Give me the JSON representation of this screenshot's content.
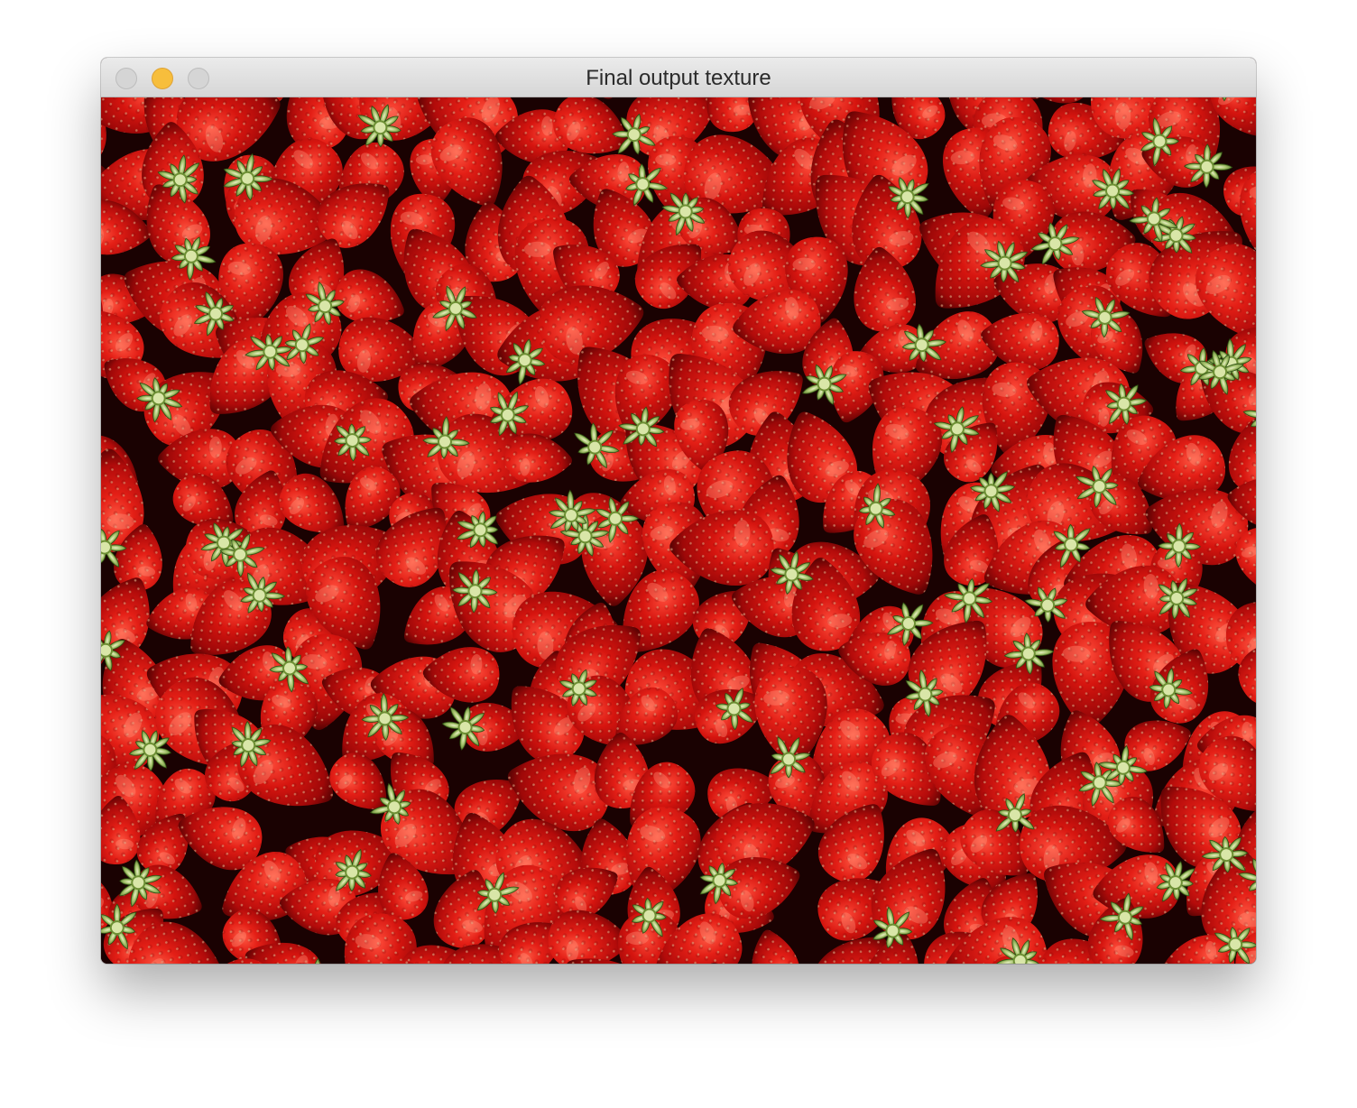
{
  "window": {
    "title": "Final output texture",
    "controls": {
      "close": "close-button",
      "minimize": "minimize-button",
      "zoom": "zoom-button"
    }
  },
  "image": {
    "subject": "strawberries-texture",
    "colors": {
      "background": "#1a0202",
      "berry": "#c8100e",
      "berry_highlight": "#f2382c",
      "berry_shadow": "#7d0606",
      "seed": "#f4d6a8",
      "leaf": "#4f7a26",
      "leaf_light": "#b9cf86"
    }
  }
}
